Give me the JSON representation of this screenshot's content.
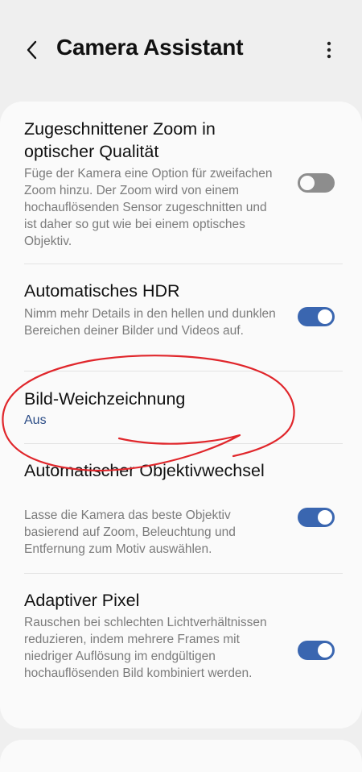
{
  "header": {
    "title": "Camera Assistant",
    "back_icon": "back-arrow-icon",
    "more_icon": "more-vertical-icon"
  },
  "settings": [
    {
      "title": "Zugeschnittener Zoom in optischer Qualität",
      "description": "Füge der Kamera eine Option für zweifachen Zoom hinzu. Der Zoom wird von einem hochauflösenden Sensor zugeschnitten und ist daher so gut wie bei einem optisches Objektiv.",
      "toggle": "off"
    },
    {
      "title": "Automatisches HDR",
      "description": "Nimm mehr Details in den hellen und dunklen Bereichen deiner Bilder und Videos auf.",
      "toggle": "on"
    },
    {
      "title": "Bild-Weichzeichnung",
      "value": "Aus"
    },
    {
      "title": "Automatischer Objektivwechsel",
      "description": "Lasse die Kamera das beste Objektiv basierend auf Zoom, Beleuchtung und Entfernung zum Motiv auswählen.",
      "toggle": "on"
    },
    {
      "title": "Adaptiver Pixel",
      "description": "Rauschen bei schlechten Lichtverhältnissen reduzieren, indem mehrere Frames mit niedriger Auflösung im endgültigen hochauflösenden Bild kombiniert werden.",
      "toggle": "on"
    }
  ],
  "colors": {
    "background": "#efefef",
    "card": "#fafafa",
    "accent": "#3a66b0",
    "value_text": "#2b4c86",
    "annotation": "#e0262b"
  }
}
